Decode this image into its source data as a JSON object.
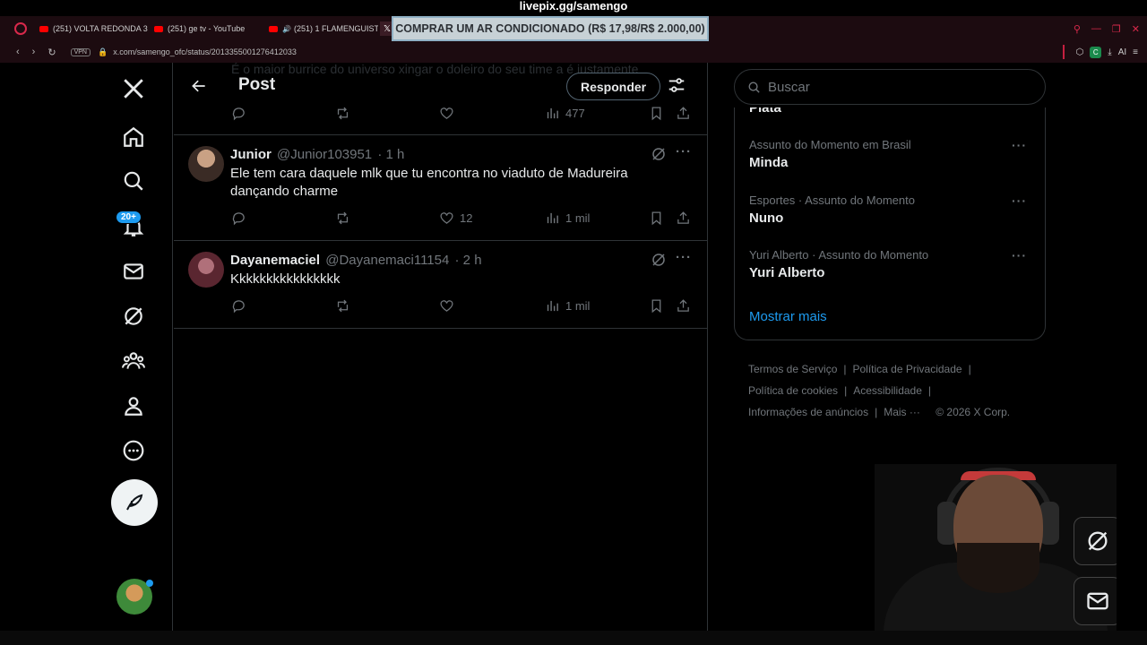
{
  "overlay": {
    "title": "livepix.gg/samengo",
    "banner": "COMPRAR UM AR CONDICIONADO (R$ 17,98/R$ 2.000,00)"
  },
  "browser": {
    "tabs": [
      {
        "label": "(251) VOLTA REDONDA 3",
        "icon": "youtube-icon"
      },
      {
        "label": "(251) ge tv - YouTube",
        "icon": "youtube-icon"
      },
      {
        "label": "(251) 1 FLAMENGUIST",
        "icon": "youtube-icon"
      }
    ],
    "vpn_label": "VPN",
    "address": "x.com/samengo_ofc/status/2013355001276412033",
    "ai_label": "AI"
  },
  "nav": {
    "notif_badge": "20+"
  },
  "header": {
    "title": "Post",
    "reply_label": "Responder",
    "ghost_text": "É o maior burrice do universo xingar o doleiro do seu time a é justamente"
  },
  "top_actions": {
    "views": "477"
  },
  "tweets": [
    {
      "name": "Junior",
      "handle": "@Junior103951",
      "time": "· 1 h",
      "text": "Ele tem cara daquele mlk que tu encontra no viaduto de Madureira dançando charme",
      "likes": "12",
      "views": "1 mil"
    },
    {
      "name": "Dayanemaciel",
      "handle": "@Dayanemaci11154",
      "time": "· 2 h",
      "text": "Kkkkkkkkkkkkkkkk",
      "likes": "",
      "views": "1 mil"
    }
  ],
  "search": {
    "placeholder": "Buscar"
  },
  "trends": {
    "cut_item": "Plata",
    "items": [
      {
        "context": "Assunto do Momento em Brasil",
        "name": "Minda"
      },
      {
        "context": "Esportes · Assunto do Momento",
        "name": "Nuno"
      },
      {
        "context": "Yuri Alberto · Assunto do Momento",
        "name": "Yuri Alberto"
      }
    ],
    "show_more": "Mostrar mais"
  },
  "footer": {
    "terms": "Termos de Serviço",
    "privacy": "Política de Privacidade",
    "cookies": "Política de cookies",
    "accessibility": "Acessibilidade",
    "ads": "Informações de anúncios",
    "more": "Mais ···",
    "copyright": "© 2026 X Corp."
  },
  "colors": {
    "accent": "#1d9bf0",
    "background": "#000000",
    "browser_chrome": "#1c0b10",
    "banner_bg": "#c7d1d6"
  }
}
